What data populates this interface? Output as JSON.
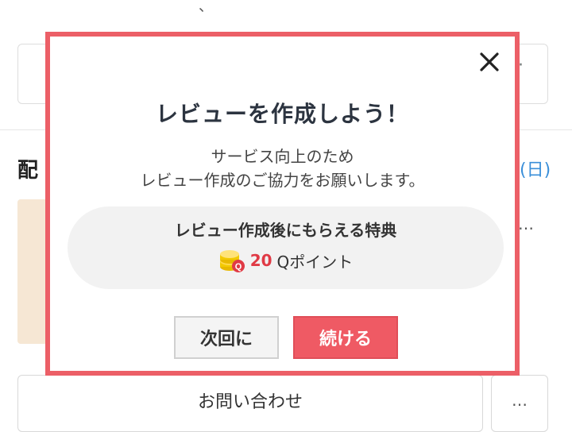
{
  "background": {
    "top_fragment": "、",
    "heading_fragment": "配",
    "date_fragment": "(日)",
    "mid_ellipsis": "…",
    "top_box_dots": "·",
    "contact_button_label": "お問い合わせ",
    "more_button_label": "…"
  },
  "modal": {
    "title": "レビューを作成しよう！",
    "description_line1": "サービス向上のため",
    "description_line2": "レビュー作成のご協力をお願いします。",
    "benefit": {
      "title": "レビュー作成後にもらえる特典",
      "amount": "20",
      "unit": "Qポイント",
      "icon": "q-point-coin-icon"
    },
    "buttons": {
      "later_label": "次回に",
      "continue_label": "続ける"
    },
    "close_icon": "close-icon"
  },
  "colors": {
    "modal_border": "#ec5f67",
    "continue_button": "#ef5a64",
    "amount_text": "#e03a45",
    "date_link": "#3a8fd9"
  }
}
